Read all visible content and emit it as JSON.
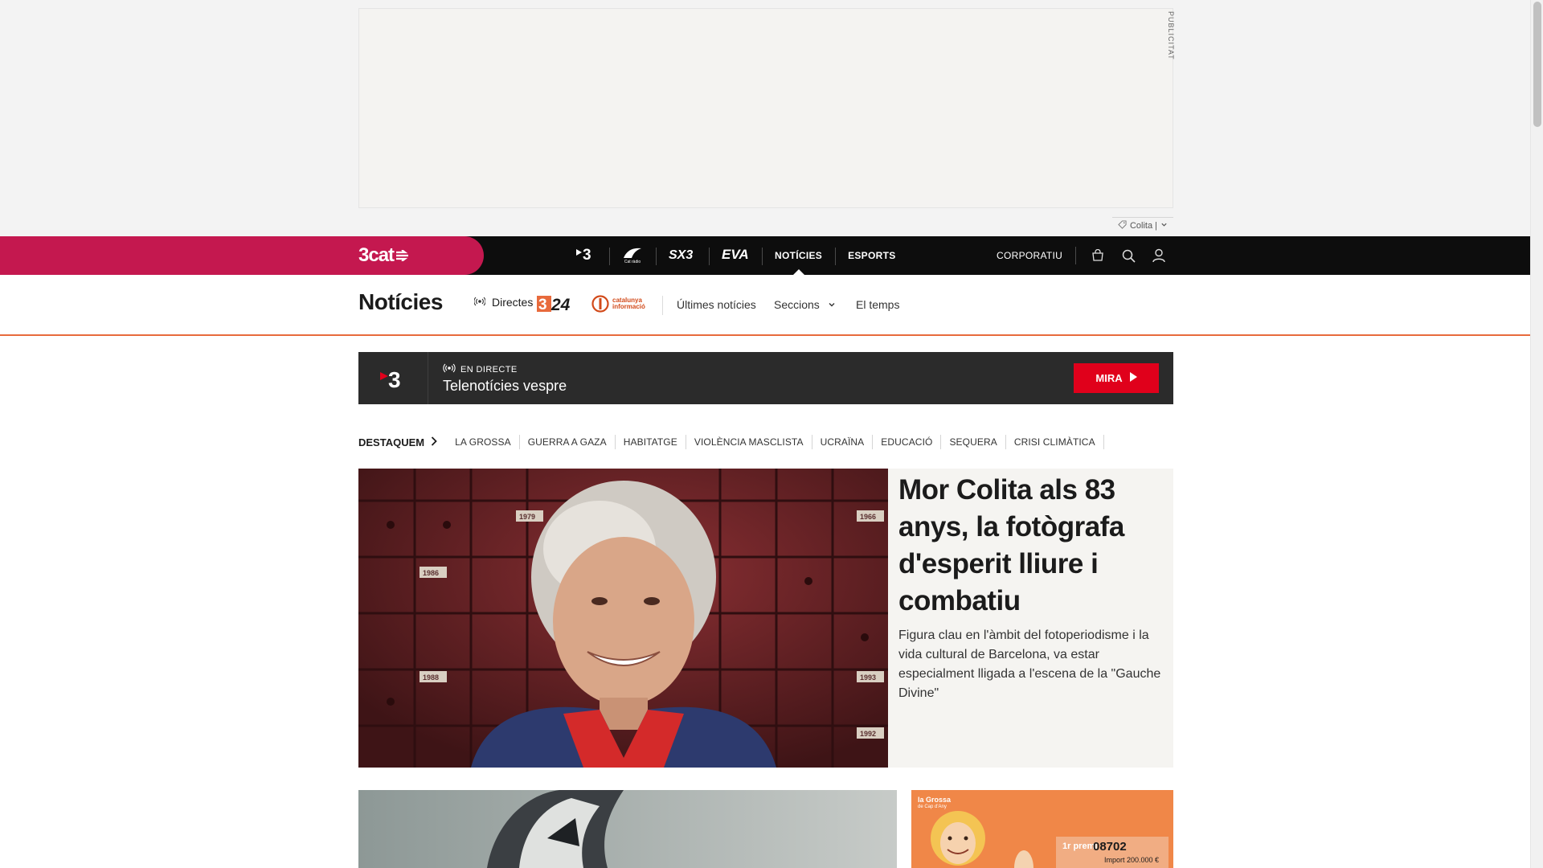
{
  "ad": {
    "label": "PUBLICITAT",
    "tag": "Colita |"
  },
  "topbar": {
    "brand": "3cat",
    "channels": [
      {
        "label": "",
        "icon": "tv3-logo-icon"
      },
      {
        "label": "",
        "icon": "catradio-logo-icon"
      },
      {
        "label": "",
        "icon": "sx3-logo-icon"
      },
      {
        "label": "",
        "icon": "eva-logo-icon"
      },
      {
        "label": "NOTÍCIES",
        "icon": ""
      },
      {
        "label": "ESPORTS",
        "icon": ""
      }
    ],
    "catradio_small": "Cat ràdio",
    "corporate": "CORPORATIU"
  },
  "secnav": {
    "title": "Notícies",
    "directes": "Directes",
    "channel_324": "324",
    "catinfo_line1": "catalunya",
    "catinfo_line2": "informació",
    "links": {
      "ultimes": "Últimes notícies",
      "seccions": "Seccions",
      "temps": "El temps"
    }
  },
  "live": {
    "tag": "EN DIRECTE",
    "title": "Telenotícies vespre",
    "button": "MIRA"
  },
  "destaquem": {
    "label": "DESTAQUEM",
    "tags": [
      "LA GROSSA",
      "GUERRA A GAZA",
      "HABITATGE",
      "VIOLÈNCIA MASCLISTA",
      "UCRAÏNA",
      "EDUCACIÓ",
      "SEQUERA",
      "CRISI CLIMÀTICA"
    ]
  },
  "hero": {
    "title": "Mor Colita als 83 anys, la fotògrafa d'esperit lliure i combatiu",
    "subtitle": "Figura clau en l'àmbit del fotoperiodisme i la vida cultural de Barcelona, va estar especialment lligada a l'escena de la \"Gauche Divine\"",
    "box_numbers": [
      "1979",
      "1986",
      "1966",
      "1988",
      "1993",
      "1992"
    ]
  },
  "cards": {
    "grossa_logo_1": "la Grossa",
    "grossa_logo_2": "de Cap d'Any",
    "prize_label": "1r premi",
    "prize_number": "08702",
    "prize_amount": "Import 200.000 €"
  },
  "colors": {
    "brand": "#c4184f",
    "live_red": "#e0001b",
    "accent_orange": "#e86a3c",
    "topbar": "#0d0d0d"
  }
}
